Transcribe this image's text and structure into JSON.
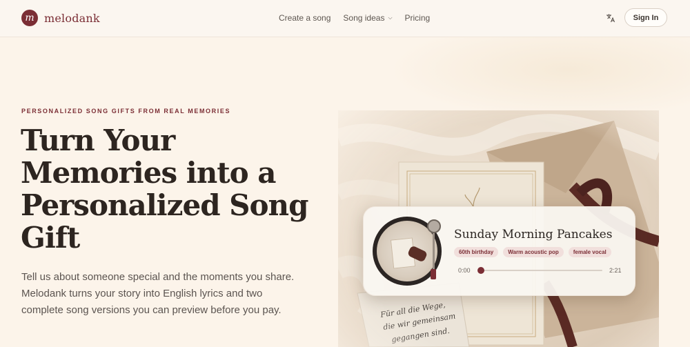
{
  "brand": {
    "logo_letter": "m",
    "name": "melodank",
    "color": "#7b2e35"
  },
  "nav": {
    "links": [
      {
        "label": "Create a song"
      },
      {
        "label": "Song ideas",
        "has_dropdown": true
      },
      {
        "label": "Pricing"
      }
    ],
    "language_icon": "translate-icon",
    "sign_in_label": "Sign In"
  },
  "hero": {
    "eyebrow": "PERSONALIZED SONG GIFTS FROM REAL MEMORIES",
    "headline": "Turn Your Memories into a Personalized Song Gift",
    "description": "Tell us about someone special and the moments you share. Melodank turns your story into English lyrics and two complete song versions you can preview before you pay."
  },
  "player": {
    "title": "Sunday Morning Pancakes",
    "tags": [
      "60th birthday",
      "Warm acoustic pop",
      "female vocal"
    ],
    "time_current": "0:00",
    "time_total": "2:21",
    "progress": 0.02
  },
  "image": {
    "card_text": "Für all die Wege, die wir gemeinsam gegangen sind."
  }
}
